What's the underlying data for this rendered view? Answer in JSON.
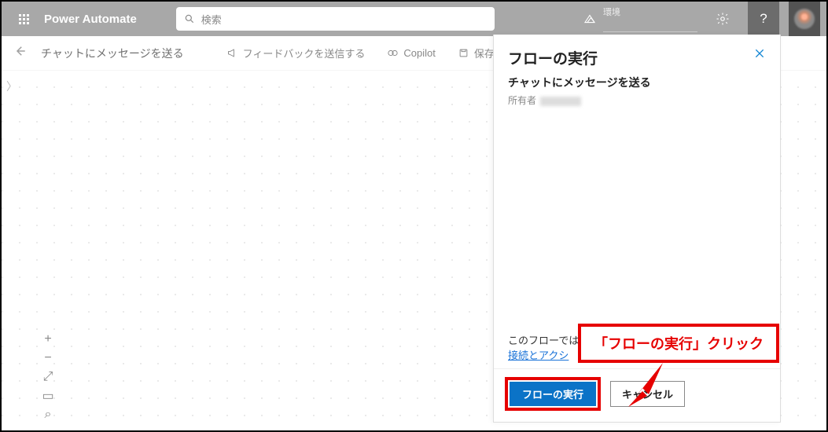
{
  "header": {
    "app_name": "Power Automate",
    "search_placeholder": "検索",
    "env_label": "環境",
    "help_glyph": "?"
  },
  "toolbar": {
    "flow_title": "チャットにメッセージを送る",
    "feedback": "フィードバックを送信する",
    "copilot": "Copilot",
    "save": "保存"
  },
  "panel": {
    "title": "フローの実行",
    "flow_name": "チャットにメッセージを送る",
    "owner_label": "所有者",
    "note_prefix": "このフローでは",
    "link_text": "接続とアクシ",
    "run_btn": "フローの実行",
    "cancel_btn": "キャンセル"
  },
  "callout": {
    "text": "「フローの実行」クリック"
  },
  "zoom": {
    "plus": "+",
    "minus": "−",
    "fit": "⤢",
    "map": "▭",
    "find": "⌕"
  }
}
